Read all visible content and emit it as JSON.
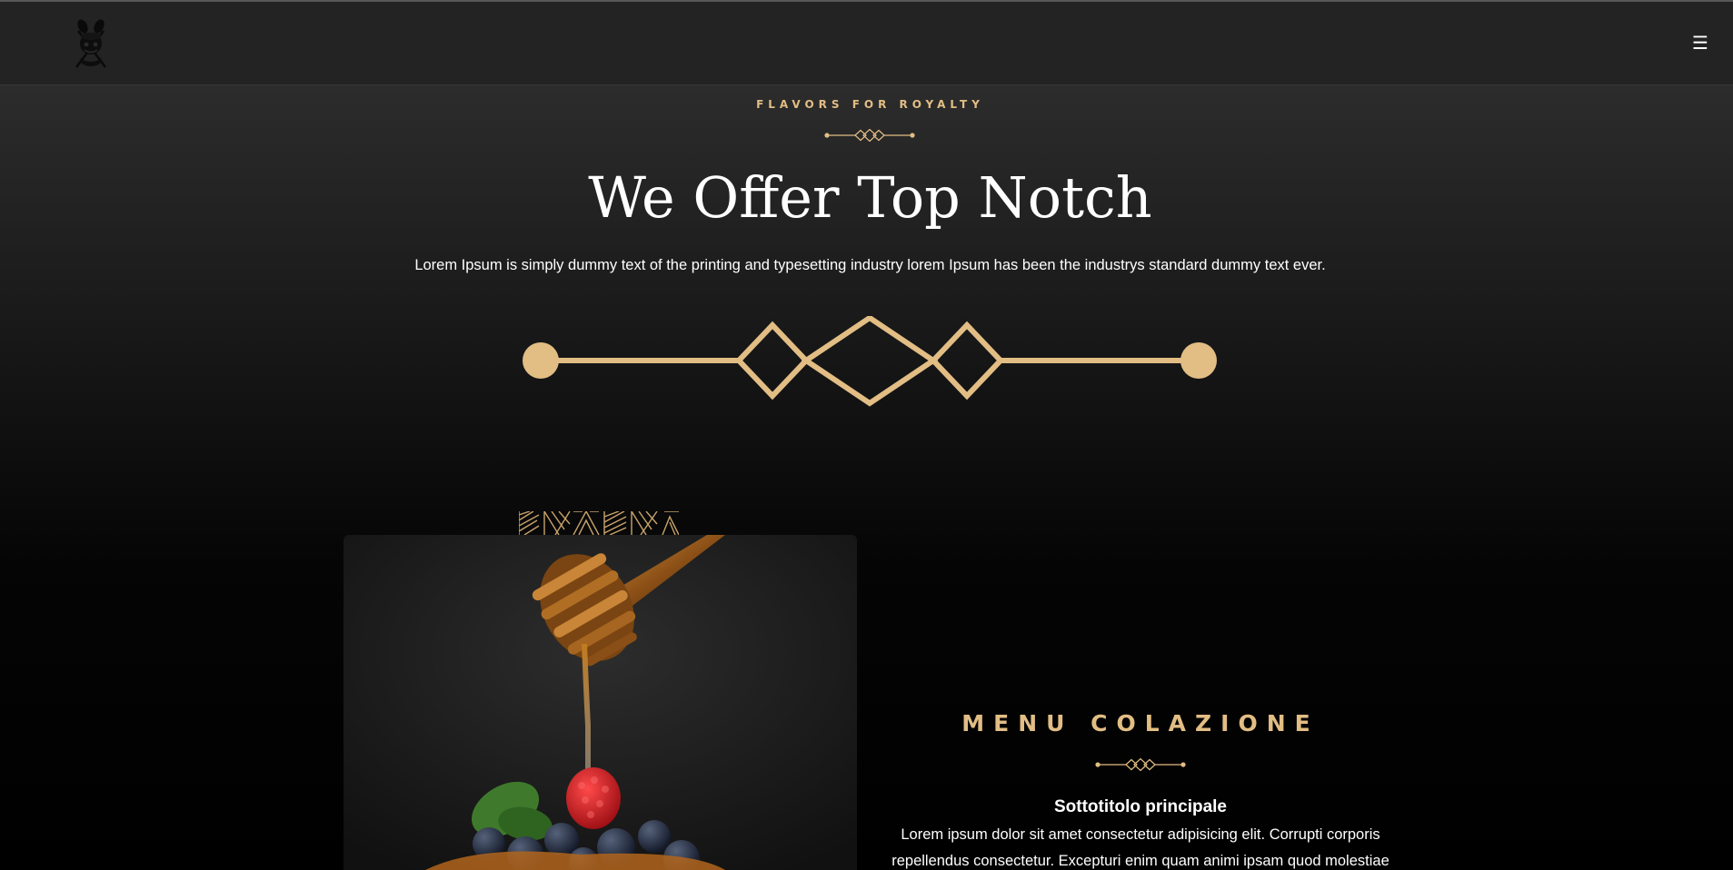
{
  "navbar": {
    "logo_icon": "chef-mascot-logo-icon",
    "menu_icon": "hamburger-menu-icon",
    "menu_glyph": "☰"
  },
  "hero": {
    "eyebrow": "FLAVORS FOR ROYALTY",
    "title": "We Offer Top Notch",
    "text": "Lorem Ipsum is simply dummy text of the printing and typesetting industry lorem Ipsum has been the industrys standard dummy text ever."
  },
  "menu_section": {
    "title": "MENU COLAZIONE",
    "subtitle": "Sottotitolo principale",
    "body": "Lorem ipsum dolor sit amet consectetur adipisicing elit. Corrupti corporis repellendus consectetur. Excepturi enim quam animi ipsam quod molestiae"
  },
  "colors": {
    "accent_gold": "#e2bd84",
    "navbar_bg": "#232323",
    "page_bg": "#000000",
    "text": "#ffffff"
  }
}
